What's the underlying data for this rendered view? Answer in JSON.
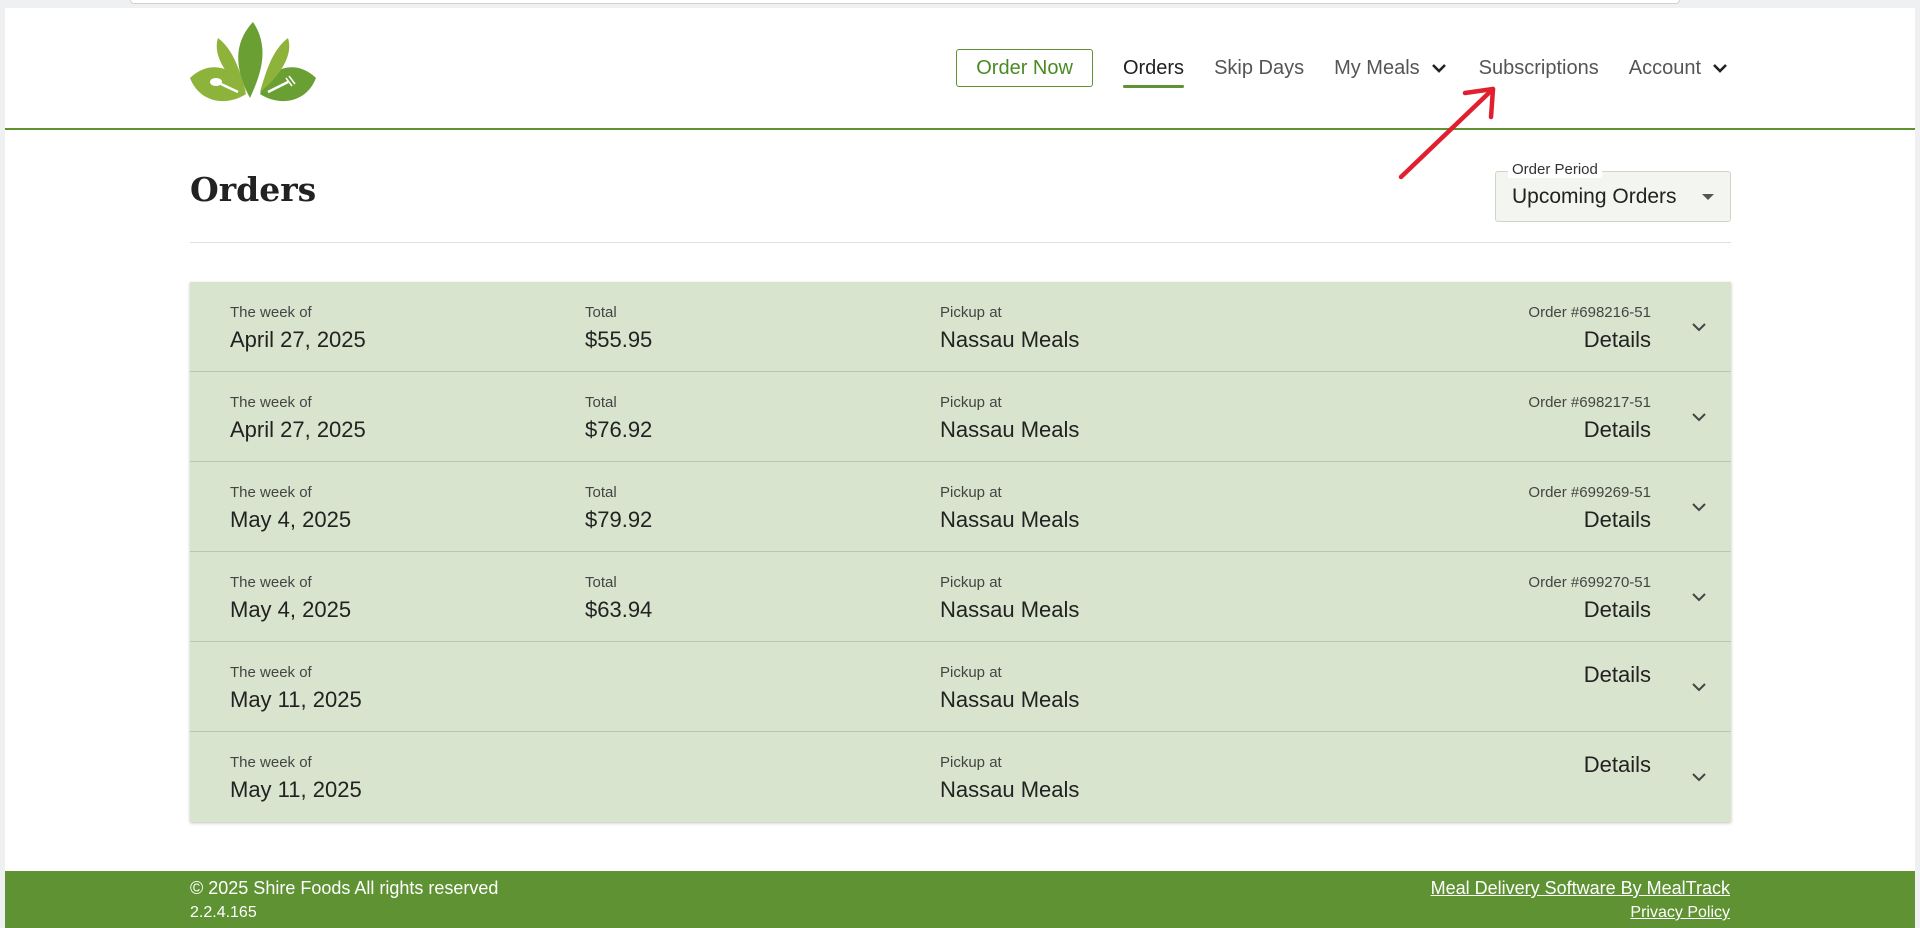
{
  "brand": {
    "logo_icon": "leaf-fork-spoon-logo",
    "accent": "#5e9233",
    "row_bg": "#d8e4cd"
  },
  "nav": {
    "order_now": "Order Now",
    "orders": "Orders",
    "skip_days": "Skip Days",
    "my_meals": "My Meals",
    "subscriptions": "Subscriptions",
    "account": "Account"
  },
  "page": {
    "title": "Orders"
  },
  "order_period": {
    "label": "Order Period",
    "value": "Upcoming Orders"
  },
  "orders": [
    {
      "week_label": "The week of",
      "week": "April 27, 2025",
      "total_label": "Total",
      "total": "$55.95",
      "pickup_label": "Pickup at",
      "pickup": "Nassau Meals",
      "order_no": "Order #698216-51",
      "details": "Details"
    },
    {
      "week_label": "The week of",
      "week": "April 27, 2025",
      "total_label": "Total",
      "total": "$76.92",
      "pickup_label": "Pickup at",
      "pickup": "Nassau Meals",
      "order_no": "Order #698217-51",
      "details": "Details"
    },
    {
      "week_label": "The week of",
      "week": "May 4, 2025",
      "total_label": "Total",
      "total": "$79.92",
      "pickup_label": "Pickup at",
      "pickup": "Nassau Meals",
      "order_no": "Order #699269-51",
      "details": "Details"
    },
    {
      "week_label": "The week of",
      "week": "May 4, 2025",
      "total_label": "Total",
      "total": "$63.94",
      "pickup_label": "Pickup at",
      "pickup": "Nassau Meals",
      "order_no": "Order #699270-51",
      "details": "Details"
    },
    {
      "week_label": "The week of",
      "week": "May 11, 2025",
      "total_label": "",
      "total": "",
      "pickup_label": "Pickup at",
      "pickup": "Nassau Meals",
      "order_no": "",
      "details": "Details"
    },
    {
      "week_label": "The week of",
      "week": "May 11, 2025",
      "total_label": "",
      "total": "",
      "pickup_label": "Pickup at",
      "pickup": "Nassau Meals",
      "order_no": "",
      "details": "Details"
    }
  ],
  "footer": {
    "copyright": "© 2025 Shire Foods All rights reserved",
    "version": "2.2.4.165",
    "software_link": "Meal Delivery Software By MealTrack",
    "privacy_link": "Privacy Policy"
  }
}
